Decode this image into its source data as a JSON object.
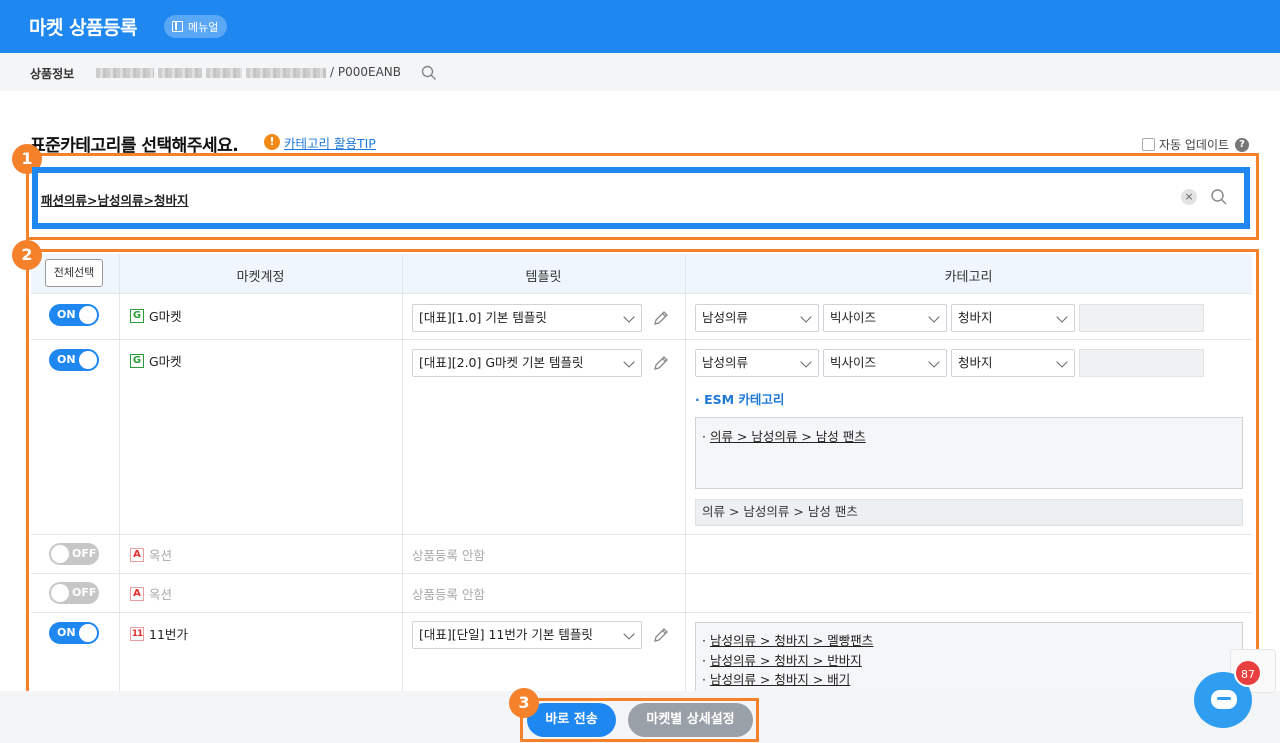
{
  "header": {
    "title": "마켓 상품등록",
    "manual_label": "메뉴얼",
    "accent": "#1e88f0"
  },
  "product_info": {
    "label": "상품정보",
    "code": "/ P000EANB"
  },
  "section": {
    "heading": "표준카테고리를 선택해주세요.",
    "tip_label": "카테고리 활용TIP",
    "auto_update_label": "자동 업데이트",
    "warn_glyph": "!",
    "help_glyph": "?"
  },
  "category_input": {
    "value": "패션의류>남성의류>청바지",
    "clear_glyph": "×"
  },
  "callouts": [
    "1",
    "2",
    "3"
  ],
  "table": {
    "select_all": "전체선택",
    "columns": [
      "마켓계정",
      "템플릿",
      "카테고리"
    ],
    "rows": [
      {
        "toggle": "ON",
        "market_icon": "G",
        "market": "G마켓",
        "template": "[대표][1.0] 기본 템플릿",
        "cat1": "남성의류",
        "cat2": "빅사이즈",
        "cat3": "청바지"
      },
      {
        "toggle": "ON",
        "market_icon": "G",
        "market": "G마켓",
        "template": "[대표][2.0] G마켓 기본 템플릿",
        "cat1": "남성의류",
        "cat2": "빅사이즈",
        "cat3": "청바지",
        "esm_label": "· ESM 카테고리",
        "esm_link_prefix": "· ",
        "esm_link": "의류 > 남성의류 > 남성 팬츠",
        "esm_selected": "의류 > 남성의류 > 남성 팬츠"
      },
      {
        "toggle": "OFF",
        "market_icon": "A",
        "market": "옥션",
        "template_text": "상품등록 안함"
      },
      {
        "toggle": "OFF",
        "market_icon": "A",
        "market": "옥션",
        "template_text": "상품등록 안함"
      },
      {
        "toggle": "ON",
        "market_icon": "11",
        "market": "11번가",
        "template": "[대표][단일] 11번가 기본 템플릿",
        "list_prefix": "· ",
        "cat_list": [
          "남성의류 > 청바지 > 멜빵팬츠",
          "남성의류 > 청바지 > 반바지",
          "남성의류 > 청바지 > 배기"
        ]
      }
    ]
  },
  "footer": {
    "send_label": "바로 전송",
    "detail_label": "마켓별 상세설정"
  },
  "chat": {
    "count": "87"
  },
  "colors": {
    "primary": "#1e88f0",
    "callout": "#f5812a",
    "off": "#c7c7c7"
  }
}
